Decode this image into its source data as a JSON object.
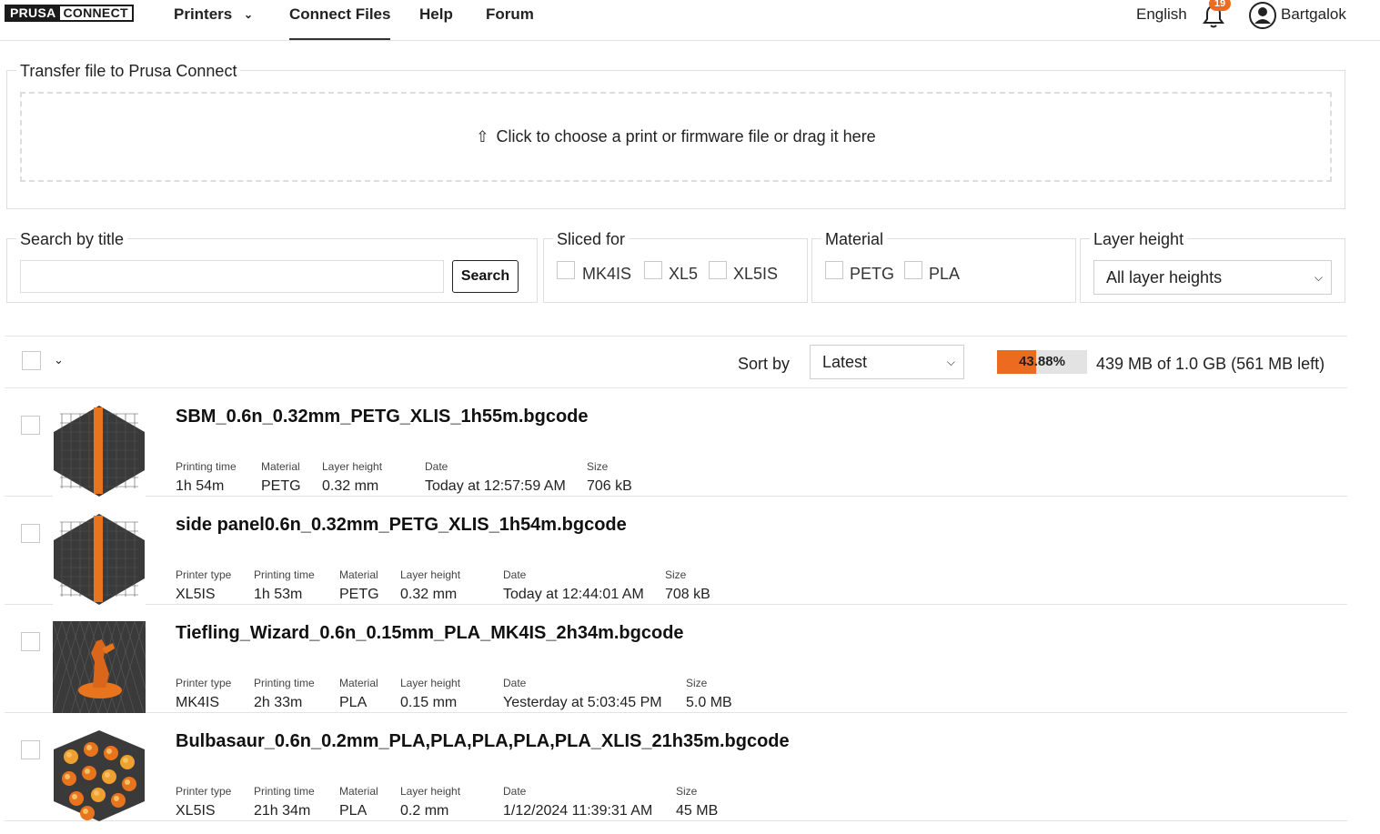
{
  "header": {
    "logo": {
      "part1": "PRUSA",
      "part2": "CONNECT"
    },
    "nav": [
      {
        "label": "Printers",
        "has_dropdown": true
      },
      {
        "label": "Connect Files",
        "active": true
      },
      {
        "label": "Help"
      },
      {
        "label": "Forum"
      }
    ],
    "language": "English",
    "notification_count": "19",
    "username": "Bartgalok"
  },
  "upload": {
    "legend": "Transfer file to Prusa Connect",
    "dropzone_text": "Click to choose a print or firmware file or drag it here",
    "icon": "upload-arrow-icon"
  },
  "filters": {
    "search": {
      "legend": "Search by title",
      "value": "",
      "button": "Search"
    },
    "sliced_for": {
      "legend": "Sliced for",
      "options": [
        "MK4IS",
        "XL5",
        "XL5IS"
      ]
    },
    "material": {
      "legend": "Material",
      "options": [
        "PETG",
        "PLA"
      ]
    },
    "layer_height": {
      "legend": "Layer height",
      "selected": "All layer heights"
    }
  },
  "list_toolbar": {
    "sort_label": "Sort by",
    "sort_selected": "Latest",
    "storage_percent_text": "43.88%",
    "storage_fraction": 0.4388,
    "storage_text": "439 MB of 1.0 GB (561 MB left)"
  },
  "colors": {
    "accent": "#ed6b21"
  },
  "files": [
    {
      "name": "SBM_0.6n_0.32mm_PETG_XLIS_1h55m.bgcode",
      "thumb": "panel",
      "meta": [
        {
          "k": "Printing time",
          "v": "1h 54m"
        },
        {
          "k": "Material",
          "v": "PETG"
        },
        {
          "k": "Layer height",
          "v": "0.32 mm"
        },
        {
          "k": "Date",
          "v": "Today at 12:57:59 AM"
        },
        {
          "k": "Size",
          "v": "706 kB"
        }
      ]
    },
    {
      "name": "side panel0.6n_0.32mm_PETG_XLIS_1h54m.bgcode",
      "thumb": "panel",
      "meta": [
        {
          "k": "Printer type",
          "v": "XL5IS"
        },
        {
          "k": "Printing time",
          "v": "1h 53m"
        },
        {
          "k": "Material",
          "v": "PETG"
        },
        {
          "k": "Layer height",
          "v": "0.32 mm"
        },
        {
          "k": "Date",
          "v": "Today at 12:44:01 AM"
        },
        {
          "k": "Size",
          "v": "708 kB"
        }
      ]
    },
    {
      "name": "Tiefling_Wizard_0.6n_0.15mm_PLA_MK4IS_2h34m.bgcode",
      "thumb": "figure",
      "meta": [
        {
          "k": "Printer type",
          "v": "MK4IS"
        },
        {
          "k": "Printing time",
          "v": "2h 33m"
        },
        {
          "k": "Material",
          "v": "PLA"
        },
        {
          "k": "Layer height",
          "v": "0.15 mm"
        },
        {
          "k": "Date",
          "v": "Yesterday at 5:03:45 PM"
        },
        {
          "k": "Size",
          "v": "5.0 MB"
        }
      ]
    },
    {
      "name": "Bulbasaur_0.6n_0.2mm_PLA,PLA,PLA,PLA,PLA_XLIS_21h35m.bgcode",
      "thumb": "multi",
      "meta": [
        {
          "k": "Printer type",
          "v": "XL5IS"
        },
        {
          "k": "Printing time",
          "v": "21h 34m"
        },
        {
          "k": "Material",
          "v": "PLA"
        },
        {
          "k": "Layer height",
          "v": "0.2 mm"
        },
        {
          "k": "Date",
          "v": "1/12/2024 11:39:31 AM"
        },
        {
          "k": "Size",
          "v": "45 MB"
        }
      ]
    }
  ]
}
